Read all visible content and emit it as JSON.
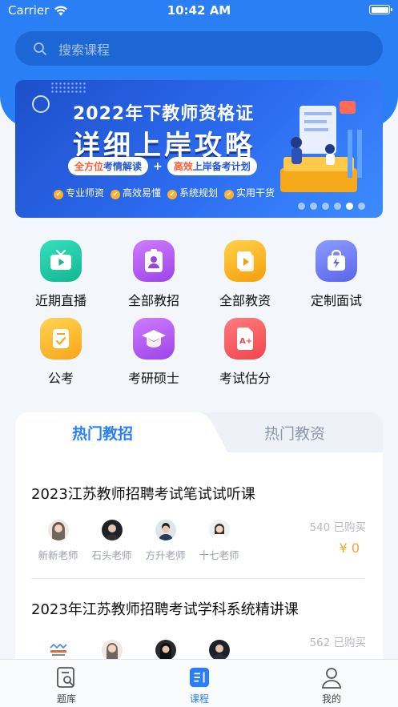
{
  "status_bar": {
    "carrier": "Carrier",
    "time": "10:42 AM"
  },
  "search": {
    "placeholder": "搜索课程"
  },
  "banner": {
    "line1": "2022年下教师资格证",
    "line2": "详细上岸攻略",
    "tag1_highlight": "全方位",
    "tag1_rest": "考情解读",
    "plus": "+",
    "tag2_highlight": "高效",
    "tag2_rest": "上岸备考计划",
    "features": [
      "专业师资",
      "高效易懂",
      "系统规划",
      "实用干货"
    ],
    "page_count": 6,
    "active_page": 4
  },
  "categories": [
    {
      "label": "近期直播",
      "icon": "tv-icon",
      "color": "#1fc7a6"
    },
    {
      "label": "全部教招",
      "icon": "id-badge-icon",
      "color": "#b25af0"
    },
    {
      "label": "全部教资",
      "icon": "play-book-icon",
      "color": "#f7b318"
    },
    {
      "label": "定制面试",
      "icon": "bag-lightning-icon",
      "color": "#6c7cf5"
    },
    {
      "label": "公考",
      "icon": "checklist-icon",
      "color": "#f9b92b"
    },
    {
      "label": "考研硕士",
      "icon": "graduation-cap-icon",
      "color": "#b25af0"
    },
    {
      "label": "考试估分",
      "icon": "a-plus-doc-icon",
      "color": "#f6595e"
    }
  ],
  "tabs": {
    "active": "热门教招",
    "inactive": "热门教资"
  },
  "courses": [
    {
      "title": "2023江苏教师招聘考试笔试试听课",
      "teachers": [
        "新新老师",
        "石头老师",
        "方升老师",
        "十七老师"
      ],
      "bought": "540 已购买",
      "price": "¥ 0"
    },
    {
      "title": "2023年江苏教师招聘考试学科系统精讲课",
      "teachers": [
        "",
        "",
        "",
        ""
      ],
      "bought": "562 已购买"
    }
  ],
  "tabbar": {
    "items": [
      "题库",
      "课程",
      "我的"
    ],
    "active": "课程"
  },
  "colors": {
    "primary": "#2b7ff5",
    "price": "#f5a623"
  }
}
